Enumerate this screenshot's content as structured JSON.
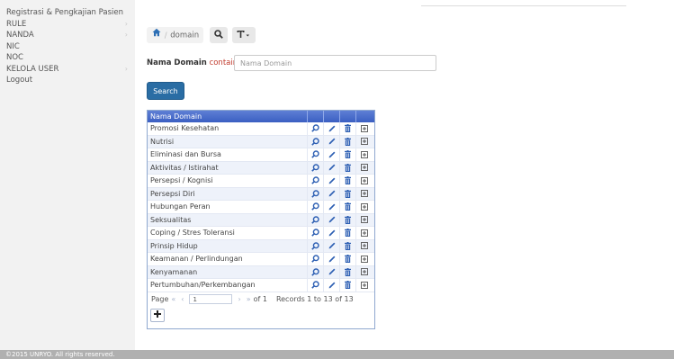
{
  "sidebar": {
    "items": [
      {
        "label": "Registrasi & Pengkajian Pasien",
        "arrow": ""
      },
      {
        "label": "RULE",
        "arrow": "›"
      },
      {
        "label": "NANDA",
        "arrow": "›"
      },
      {
        "label": "NIC",
        "arrow": ""
      },
      {
        "label": "NOC",
        "arrow": ""
      },
      {
        "label": "KELOLA USER",
        "arrow": "›"
      },
      {
        "label": "Logout",
        "arrow": ""
      }
    ]
  },
  "breadcrumb": {
    "separator": "/",
    "current": "domain"
  },
  "filter": {
    "field_label": "Nama Domain",
    "operator": "contains",
    "placeholder": "Nama Domain"
  },
  "search_button": "Search",
  "grid": {
    "header": "Nama Domain",
    "rows": [
      "Promosi Kesehatan",
      "Nutrisi",
      "Eliminasi dan Bursa",
      "Aktivitas / Istirahat",
      "Persepsi / Kognisi",
      "Persepsi Diri",
      "Hubungan Peran",
      "Seksualitas",
      "Coping / Stres Toleransi",
      "Prinsip Hidup",
      "Keamanan / Perlindungan",
      "Kenyamanan",
      "Pertumbuhan/Perkembangan"
    ],
    "pager": {
      "page_label": "Page",
      "first": "«",
      "prev": "‹",
      "page_value": "1",
      "next": "›",
      "last": "»",
      "of_text": "of 1",
      "records_text": "Records 1 to 13 of 13"
    }
  },
  "footer": "©2015 UNRYO. All rights reserved.",
  "colors": {
    "grid_header": "#3b5fc2",
    "search_button": "#2a6da4",
    "operator_text": "#c0392b",
    "action_icon": "#2d5fb3",
    "footer_bg": "#b0b0b0"
  }
}
